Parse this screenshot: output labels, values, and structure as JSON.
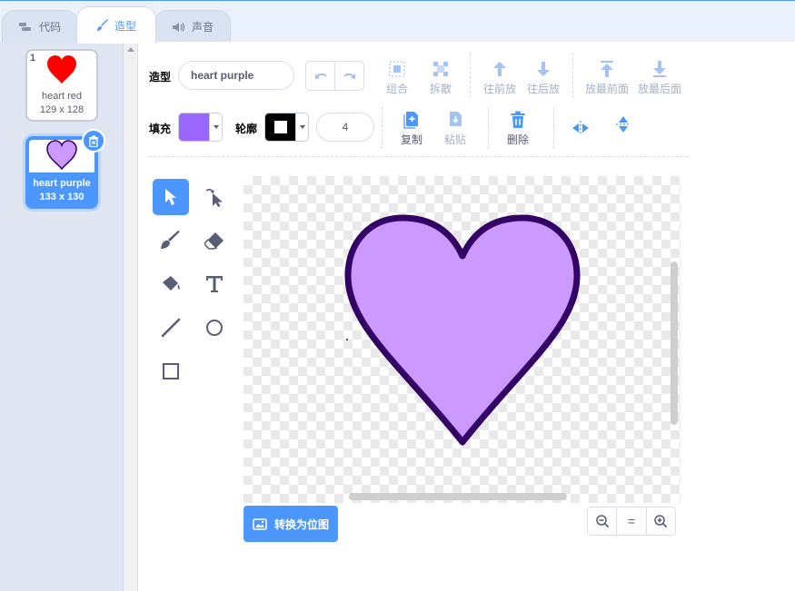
{
  "tabs": [
    {
      "label": "代码",
      "icon": "code-icon"
    },
    {
      "label": "造型",
      "icon": "brush-icon",
      "active": true
    },
    {
      "label": "声音",
      "icon": "speaker-icon"
    }
  ],
  "costumes": [
    {
      "number": "1",
      "name": "heart red",
      "size": "129 x 128",
      "color": "#ff0000",
      "selected": false
    },
    {
      "number": "2",
      "name": "heart purple",
      "size": "133 x 130",
      "color": "#cc99ff",
      "selected": true
    }
  ],
  "toolbar": {
    "costume_label": "造型",
    "costume_name": "heart purple",
    "group": "组合",
    "ungroup": "拆散",
    "forward": "往前放",
    "backward": "往后放",
    "front": "放最前面",
    "back": "放最后面",
    "fill_label": "填充",
    "fill_color": "#9966ff",
    "outline_label": "轮廓",
    "outline_color": "#000000",
    "outline_width": "4",
    "copy": "复制",
    "paste": "粘贴",
    "delete": "删除"
  },
  "tools": [
    "select-tool",
    "reshape-tool",
    "brush-tool",
    "eraser-tool",
    "fill-tool",
    "text-tool",
    "line-tool",
    "circle-tool",
    "rect-tool"
  ],
  "canvas": {
    "shape_fill": "#cc99ff",
    "shape_stroke": "#330066"
  },
  "footer": {
    "convert_bitmap": "转换为位图",
    "zoom_reset": "="
  },
  "colors": {
    "accent": "#4c97ff"
  }
}
